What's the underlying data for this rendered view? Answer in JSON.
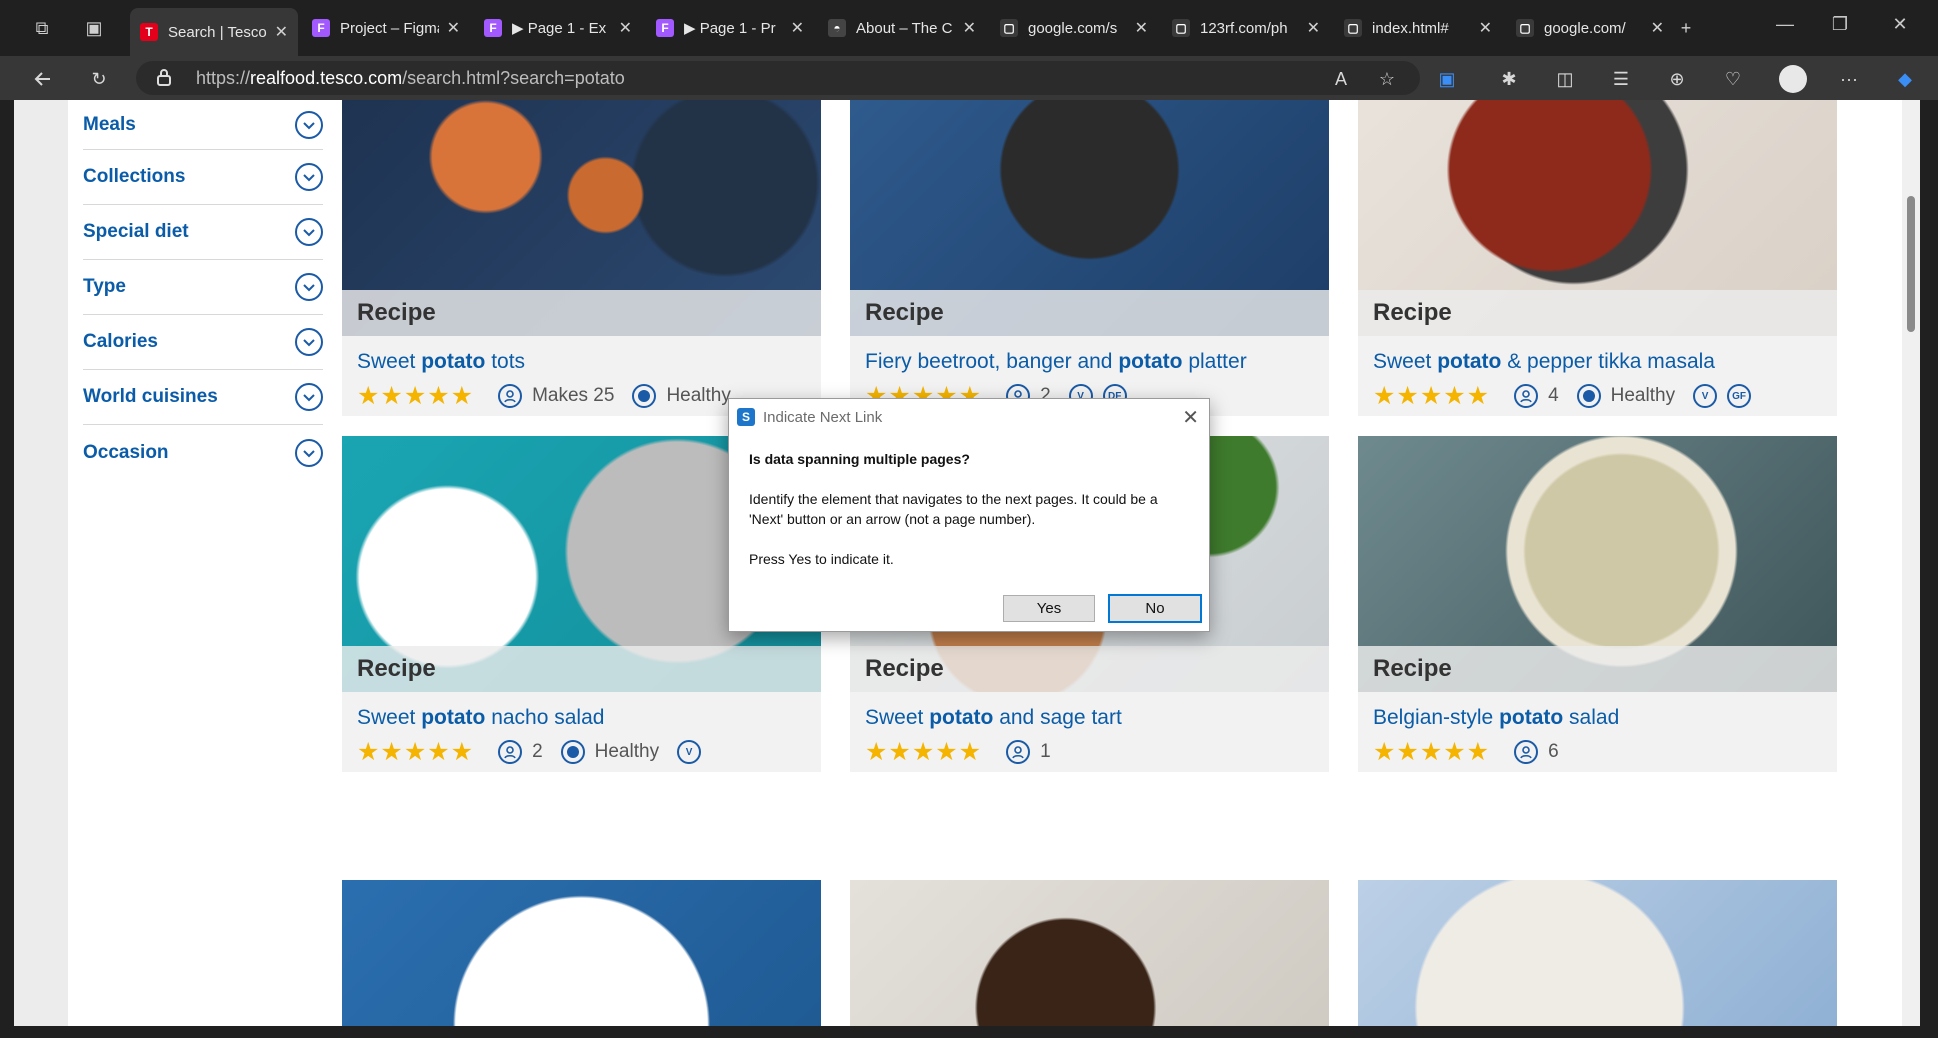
{
  "browser": {
    "tabs": [
      {
        "title": "Search | Tesco",
        "favicon": "T",
        "favicon_color": "#e2001a",
        "active": true
      },
      {
        "title": "Project – Figma",
        "favicon": "F",
        "favicon_color": "#a259ff",
        "active": false
      },
      {
        "title": "▶ Page 1 - Ex",
        "favicon": "F",
        "favicon_color": "#a259ff",
        "active": false
      },
      {
        "title": "▶ Page 1 - Pr",
        "favicon": "F",
        "favicon_color": "#a259ff",
        "active": false
      },
      {
        "title": "About – The C",
        "favicon": "◓",
        "favicon_color": "#444444",
        "active": false
      },
      {
        "title": "google.com/s",
        "favicon": "▢",
        "favicon_color": "#3a3a3a",
        "active": false
      },
      {
        "title": "123rf.com/ph",
        "favicon": "▢",
        "favicon_color": "#3a3a3a",
        "active": false
      },
      {
        "title": "index.html#",
        "favicon": "▢",
        "favicon_color": "#3a3a3a",
        "active": false
      },
      {
        "title": "google.com/",
        "favicon": "▢",
        "favicon_color": "#3a3a3a",
        "active": false
      }
    ],
    "new_tab": "+",
    "url_prefix": "https://",
    "url_host": "realfood.tesco.com",
    "url_path": "/search.html?search=potato"
  },
  "sidebar": {
    "filters": [
      "Meals",
      "Collections",
      "Special diet",
      "Type",
      "Calories",
      "World cuisines",
      "Occasion"
    ]
  },
  "cards": [
    {
      "label": "Recipe",
      "title_pre": "Sweet ",
      "title_bold": "potato",
      "title_post": " tots",
      "stars": "★★★★★",
      "serves": "Makes 25",
      "tags": [
        "Healthy"
      ],
      "badges": []
    },
    {
      "label": "Recipe",
      "title_pre": "Fiery beetroot, banger and ",
      "title_bold": "potato",
      "title_post": " platter",
      "stars": "★★★★★",
      "serves": "2",
      "tags": [],
      "badges": [
        "V",
        "DF"
      ]
    },
    {
      "label": "Recipe",
      "title_pre": "Sweet ",
      "title_bold": "potato",
      "title_post": " & pepper tikka masala",
      "stars": "★★★★★",
      "serves": "4",
      "tags": [
        "Healthy"
      ],
      "badges": [
        "V",
        "GF"
      ]
    },
    {
      "label": "Recipe",
      "title_pre": "Sweet ",
      "title_bold": "potato",
      "title_post": " nacho salad",
      "stars": "★★★★★",
      "serves": "2",
      "tags": [
        "Healthy"
      ],
      "badges": [
        "V"
      ]
    },
    {
      "label": "Recipe",
      "title_pre": "Sweet ",
      "title_bold": "potato",
      "title_post": " and sage tart",
      "stars": "★★★★★",
      "serves": "1",
      "tags": [],
      "badges": []
    },
    {
      "label": "Recipe",
      "title_pre": "Belgian-style ",
      "title_bold": "potato",
      "title_post": " salad",
      "stars": "★★★★★",
      "serves": "6",
      "tags": [],
      "badges": []
    }
  ],
  "dialog": {
    "title": "Indicate Next Link",
    "question": "Is data spanning multiple pages?",
    "body": "Identify the element that navigates to the next pages. It could be a 'Next' button or an arrow (not a page number).",
    "instruction": "Press Yes to indicate it.",
    "yes_label": "Yes",
    "no_label": "No"
  },
  "colors": {
    "link_blue": "#0b5ca8",
    "star_gold": "#f4b400",
    "tesco_red": "#e2001a"
  }
}
